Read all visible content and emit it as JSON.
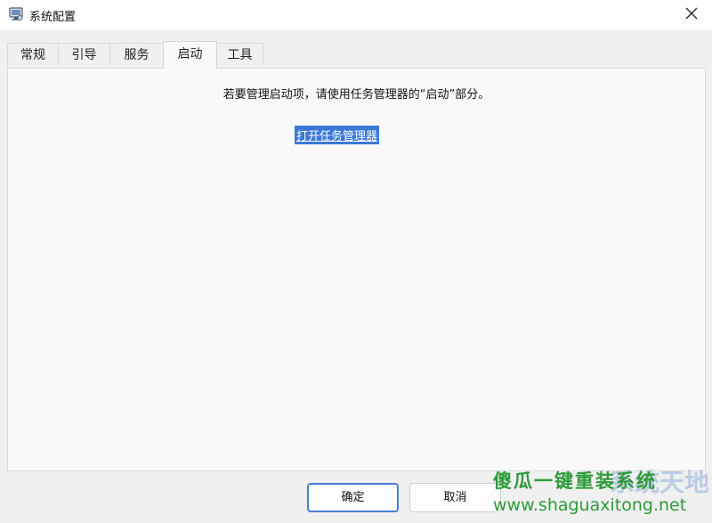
{
  "window": {
    "title": "系统配置",
    "close_symbol": "✕",
    "icon": "system-config-icon"
  },
  "tabs": [
    {
      "label": "常规",
      "active": false
    },
    {
      "label": "引导",
      "active": false
    },
    {
      "label": "服务",
      "active": false
    },
    {
      "label": "启动",
      "active": true
    },
    {
      "label": "工具",
      "active": false
    }
  ],
  "startup_panel": {
    "info_text": "若要管理启动项，请使用任务管理器的“启动”部分。",
    "link_label": "打开任务管理器"
  },
  "footer": {
    "ok_label": "确定",
    "cancel_label": "取消"
  },
  "watermark": {
    "title": "傻瓜一键重装系统",
    "url": "www.shaguaxitong.net",
    "brand": "系统天地"
  },
  "colors": {
    "accent": "#3b78d8",
    "background": "#f0f0f0",
    "panel": "#f9f9f9",
    "watermark_green": "#2e9a3a"
  }
}
